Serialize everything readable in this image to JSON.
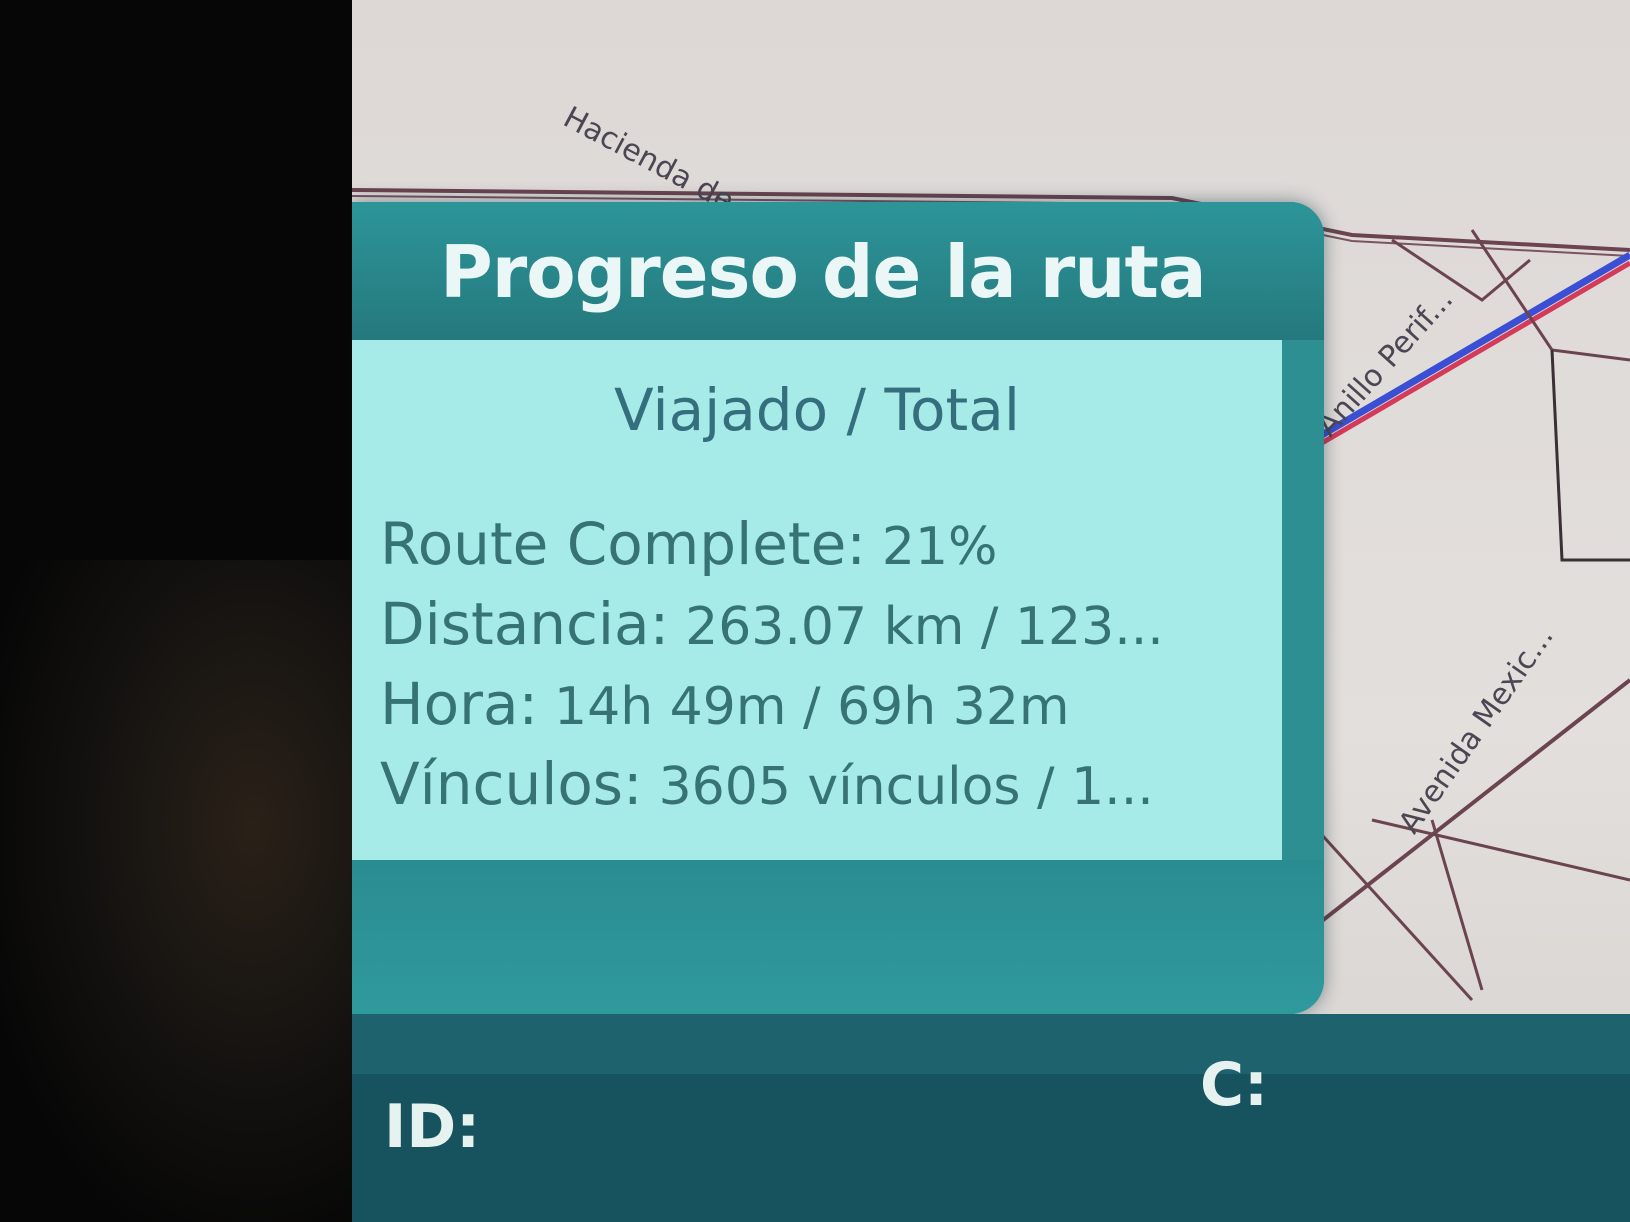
{
  "map": {
    "street_labels": [
      "Hacienda de...",
      "Anillo Perif...",
      "Avenida Mexic..."
    ]
  },
  "route_progress": {
    "title": "Progreso de la ruta",
    "subtitle": "Viajado / Total",
    "route_complete": {
      "label": "Route Complete:",
      "value": "21%"
    },
    "distance": {
      "label": "Distancia:",
      "value": "263.07 km / 123..."
    },
    "time": {
      "label": "Hora:",
      "value": "14h 49m / 69h 32m"
    },
    "links": {
      "label": "Vínculos:",
      "value": "3605 vínculos / 1..."
    }
  },
  "status_bar": {
    "id_label": "ID:",
    "c_label": "C:"
  },
  "colors": {
    "panel_teal": "#2e8f93",
    "panel_body": "#a6ebe7",
    "route_line": "#d43a5a",
    "route_line_blue": "#3a4fd4"
  }
}
